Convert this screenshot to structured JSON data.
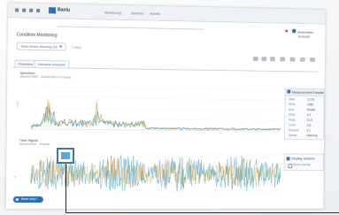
{
  "app": {
    "logo_text": "Bantu",
    "menu": [
      "Monitoring",
      "Sensors",
      "Assets"
    ],
    "user": "Maximilian Schmidt"
  },
  "page": {
    "title": "Condition Monitoring",
    "sensor_select": "Main Motor Bearing DE",
    "range_field": "7 days"
  },
  "tabs": [
    {
      "label": "Overview",
      "active": false
    },
    {
      "label": "Vibration Analysis",
      "active": true
    }
  ],
  "chart1": {
    "title": "Spectrum",
    "subtitle": "Velocity RMS · Acceleration Envelope",
    "ylabel": "mm/s",
    "colors": {
      "a": "#3f9ec7",
      "b": "#e2a435"
    }
  },
  "chart2": {
    "title": "Time Signal",
    "subtitle": "Acceleration · Velocity",
    "ylabel": "g",
    "colors": {
      "a": "#3f9ec7",
      "b": "#e2a435"
    }
  },
  "side_panel": {
    "title": "Measurement Details",
    "rows": [
      {
        "k": "Date",
        "v": "12.03."
      },
      {
        "k": "RPM",
        "v": "1480"
      },
      {
        "k": "Axis",
        "v": "Radial"
      },
      {
        "k": "RMS",
        "v": "4.2"
      },
      {
        "k": "Peak",
        "v": "11.8"
      },
      {
        "k": "Crest",
        "v": "2.8"
      },
      {
        "k": "Kurtosis",
        "v": "3.1"
      },
      {
        "k": "Status",
        "v": "Warning"
      }
    ]
  },
  "side_panel2": {
    "title": "Display Options",
    "option": "Show overlay"
  },
  "help_button": "Need help?",
  "accent_color": "#2d6fb8"
}
